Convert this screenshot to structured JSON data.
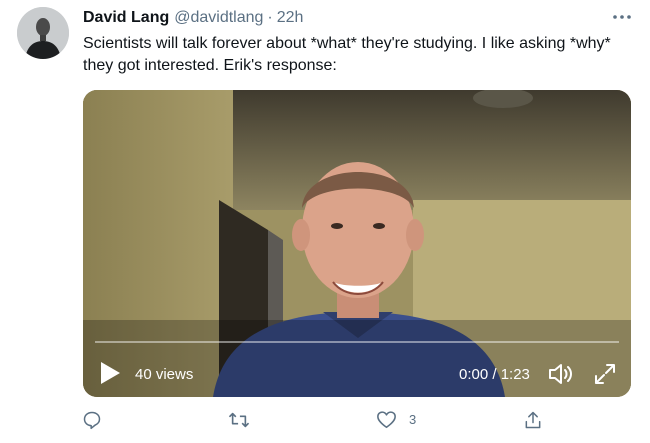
{
  "tweet": {
    "display_name": "David Lang",
    "handle": "@davidtlang",
    "separator": "·",
    "time": "22h",
    "text": "Scientists will talk forever about *what* they're studying. I like asking *why* they got interested. Erik's response:",
    "avatar_icon": "profile-photo-avatar",
    "more_icon": "more-dots-icon"
  },
  "video": {
    "views": "40 views",
    "time": "0:00 / 1:23",
    "progress": 0,
    "play_icon": "play-icon",
    "volume_icon": "volume-icon",
    "fullscreen_icon": "fullscreen-icon"
  },
  "actions": {
    "reply_icon": "reply-icon",
    "retweet_icon": "retweet-icon",
    "like_icon": "heart-icon",
    "like_count": "3",
    "share_icon": "share-icon"
  },
  "colors": {
    "text": "#0f1419",
    "secondary": "#5b7083",
    "video_overlay_text": "#ffffff"
  }
}
